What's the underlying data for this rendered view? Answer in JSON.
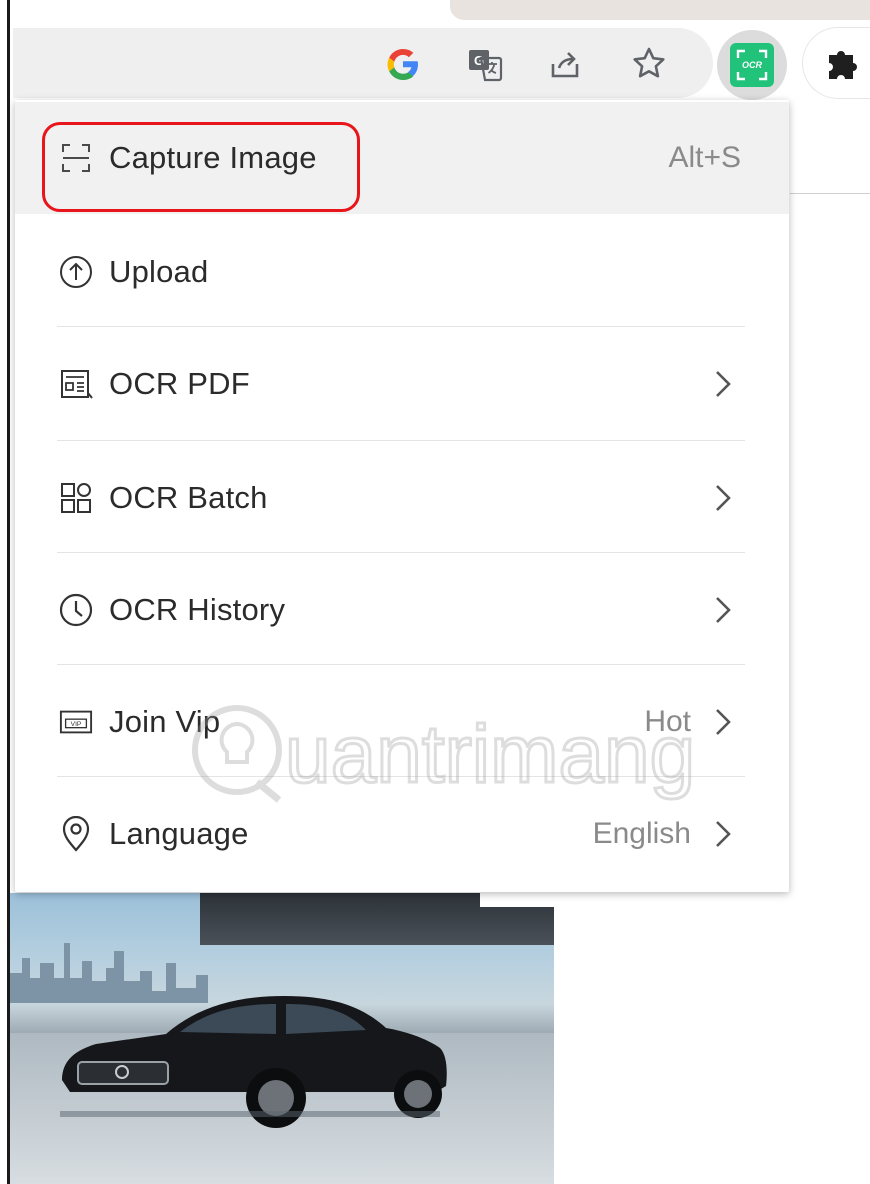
{
  "toolbar": {
    "icons": [
      "google-icon",
      "translate-icon",
      "share-icon",
      "bookmark-star-icon"
    ],
    "extension": {
      "name": "ocr-extension-icon",
      "badge_text": "OCR",
      "color": "#21c27a"
    },
    "puzzle": "extensions-puzzle-icon"
  },
  "menu": {
    "items": [
      {
        "label": "Capture Image",
        "icon": "capture-frame-icon",
        "shortcut": "Alt+S",
        "selected": true
      },
      {
        "label": "Upload",
        "icon": "upload-circle-icon"
      },
      {
        "label": "OCR PDF",
        "icon": "pdf-document-icon",
        "submenu": true
      },
      {
        "label": "OCR Batch",
        "icon": "batch-grid-icon",
        "submenu": true
      },
      {
        "label": "OCR History",
        "icon": "history-clock-icon",
        "submenu": true
      },
      {
        "label": "Join Vip",
        "icon": "vip-card-icon",
        "badge": "Hot",
        "submenu": true
      },
      {
        "label": "Language",
        "icon": "location-pin-icon",
        "value": "English",
        "submenu": true
      }
    ],
    "highlight_color": "#e8151b"
  },
  "watermark": {
    "text": "uantrimang"
  }
}
